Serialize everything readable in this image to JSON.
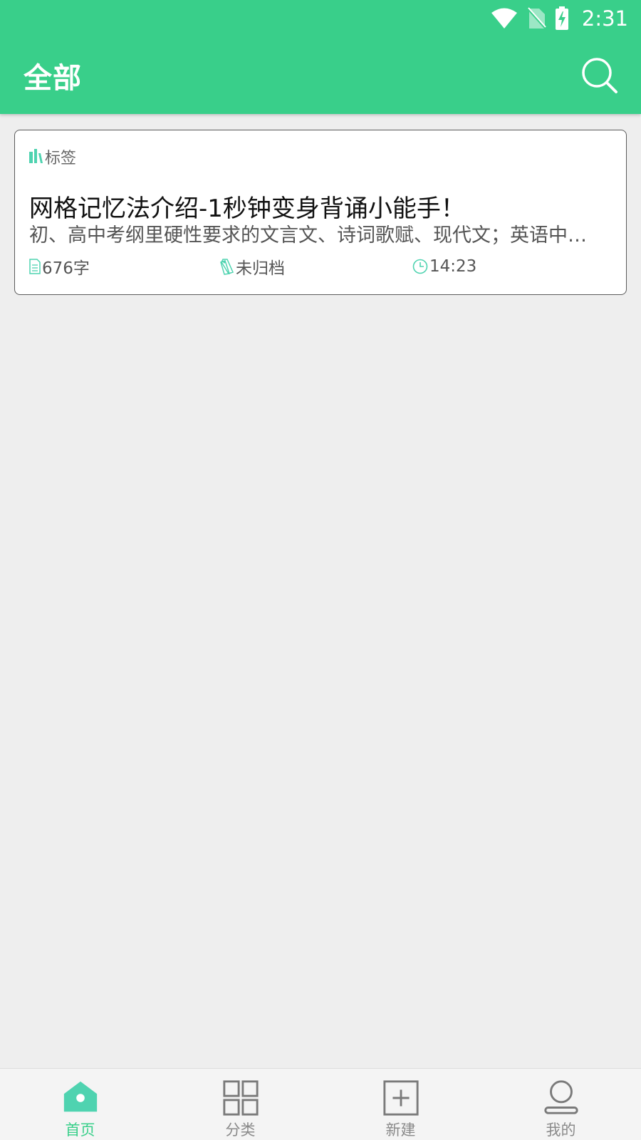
{
  "status_bar": {
    "time": "2:31",
    "icons": [
      "wifi-icon",
      "no-sim-icon",
      "battery-charging-icon"
    ]
  },
  "app_bar": {
    "title": "全部",
    "search_icon": "search-icon"
  },
  "notes": [
    {
      "tag": "标签",
      "title": "网格记忆法介绍-1秒钟变身背诵小能手！",
      "preview": "初、高中考纲里硬性要求的文言文、诗词歌赋、现代文；英语中…",
      "word_count": "676字",
      "archive_status": "未归档",
      "time": "14:23"
    }
  ],
  "bottom_nav": {
    "items": [
      {
        "label": "首页",
        "icon": "home-icon",
        "active": true
      },
      {
        "label": "分类",
        "icon": "grid-icon",
        "active": false
      },
      {
        "label": "新建",
        "icon": "add-icon",
        "active": false
      },
      {
        "label": "我的",
        "icon": "profile-icon",
        "active": false
      }
    ]
  },
  "colors": {
    "primary": "#39cf8a",
    "icon_accent": "#4fd3b0",
    "background": "#eeeeee",
    "nav_inactive": "#8a8a8a"
  }
}
